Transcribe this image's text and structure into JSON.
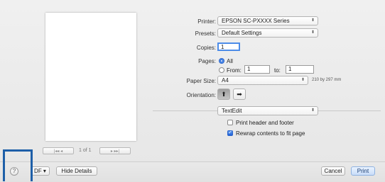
{
  "preview": {
    "page_label": "1 of 1",
    "nav_first_prev": "|◂◂  ◂",
    "nav_next_last": "▸  ▸▸|"
  },
  "settings": {
    "printer_label": "Printer:",
    "printer_value": "EPSON SC-PXXXX Series",
    "presets_label": "Presets:",
    "presets_value": "Default Settings",
    "copies_label": "Copies:",
    "copies_value": "1",
    "pages_label": "Pages:",
    "pages_all_label": "All",
    "pages_from_label": "From:",
    "pages_from_value": "1",
    "pages_to_label": "to:",
    "pages_to_value": "1",
    "paper_size_label": "Paper Size:",
    "paper_size_value": "A4",
    "paper_size_dims": "210 by 297 mm",
    "orientation_label": "Orientation:",
    "orientation_portrait": "⬆",
    "orientation_landscape": "➡",
    "app_section_value": "TextEdit",
    "print_header_footer_label": "Print header and footer",
    "print_header_footer_checked": false,
    "rewrap_label": "Rewrap contents to fit page",
    "rewrap_checked": true
  },
  "bottom": {
    "help_glyph": "?",
    "pdf_label": "DF ▾",
    "hide_details_label": "Hide Details",
    "cancel_label": "Cancel",
    "print_label": "Print"
  },
  "colors": {
    "accent_blue": "#1f5fd6",
    "callout_border": "#1e5fa8"
  }
}
